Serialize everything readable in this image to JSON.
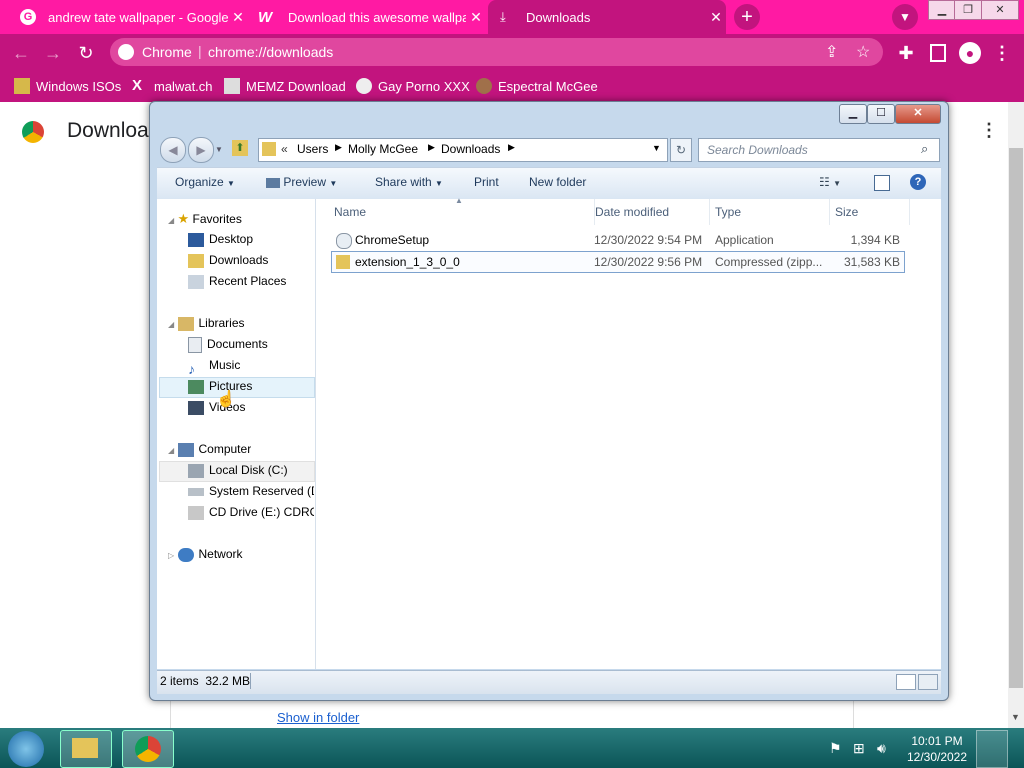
{
  "tabs": [
    {
      "title": "andrew tate wallpaper - Google"
    },
    {
      "title": "Download this awesome wallpa"
    },
    {
      "title": "Downloads"
    }
  ],
  "omnibox": {
    "site_label": "Chrome",
    "url": "chrome://downloads"
  },
  "bookmarks": [
    "Windows ISOs",
    "malwat.ch",
    "MEMZ Download",
    "Gay Porno XXX",
    "Espectral McGee"
  ],
  "chrome_page": {
    "title": "Downloa",
    "show_in_folder": "Show in folder"
  },
  "explorer": {
    "breadcrumb": [
      "Users",
      "Molly McGee",
      "Downloads"
    ],
    "search_placeholder": "Search Downloads",
    "commands": [
      "Organize",
      "Preview",
      "Share with",
      "Print",
      "New folder"
    ],
    "nav": {
      "favorites": {
        "label": "Favorites",
        "items": [
          "Desktop",
          "Downloads",
          "Recent Places"
        ]
      },
      "libraries": {
        "label": "Libraries",
        "items": [
          "Documents",
          "Music",
          "Pictures",
          "Videos"
        ]
      },
      "computer": {
        "label": "Computer",
        "items": [
          "Local Disk (C:)",
          "System Reserved (D:",
          "CD Drive (E:) CDROM"
        ]
      },
      "network": {
        "label": "Network"
      }
    },
    "columns": [
      "Name",
      "Date modified",
      "Type",
      "Size"
    ],
    "files": [
      {
        "name": "ChromeSetup",
        "date": "12/30/2022 9:54 PM",
        "type": "Application",
        "size": "1,394 KB"
      },
      {
        "name": "extension_1_3_0_0",
        "date": "12/30/2022 9:56 PM",
        "type": "Compressed (zipp...",
        "size": "31,583 KB"
      }
    ],
    "status": "2 items  32.2 MB"
  },
  "taskbar": {
    "time": "10:01 PM",
    "date": "12/30/2022"
  },
  "colors": {
    "tab_strip": "#ff1aa3",
    "toolbar": "#c2147e",
    "taskbar": "#0b5557"
  }
}
